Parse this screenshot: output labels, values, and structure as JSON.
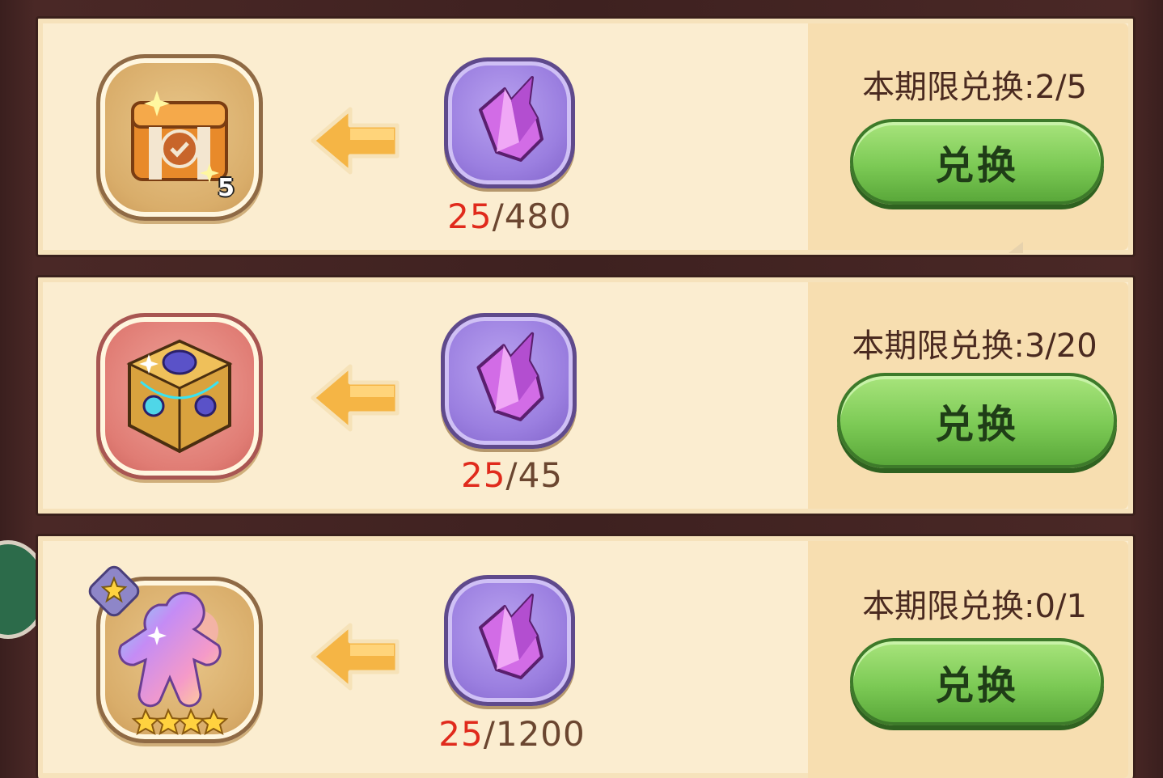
{
  "exchange": {
    "items": [
      {
        "reward_icon": "treasure-chest-icon",
        "reward_count": "5",
        "currency_icon": "purple-crystal-icon",
        "have": "25",
        "cost": "/480",
        "limit_text": "本期限兑换:2/5",
        "button_label": "兑换"
      },
      {
        "reward_icon": "jewel-cube-chest-icon",
        "reward_count": "",
        "currency_icon": "purple-crystal-icon",
        "have": "25",
        "cost": "/45",
        "limit_text": "本期限兑换:3/20",
        "button_label": "兑换"
      },
      {
        "reward_icon": "rainbow-cookie-soulstone-icon",
        "reward_count": "",
        "currency_icon": "purple-crystal-icon",
        "have": "25",
        "cost": "/1200",
        "limit_text": "本期限兑换:0/1",
        "button_label": "兑换"
      }
    ]
  },
  "colors": {
    "have_red": "#e02a1c",
    "button_green": "#7cca55",
    "panel_cream": "#fbedd0",
    "crystal_purple": "#9b7fe0"
  }
}
